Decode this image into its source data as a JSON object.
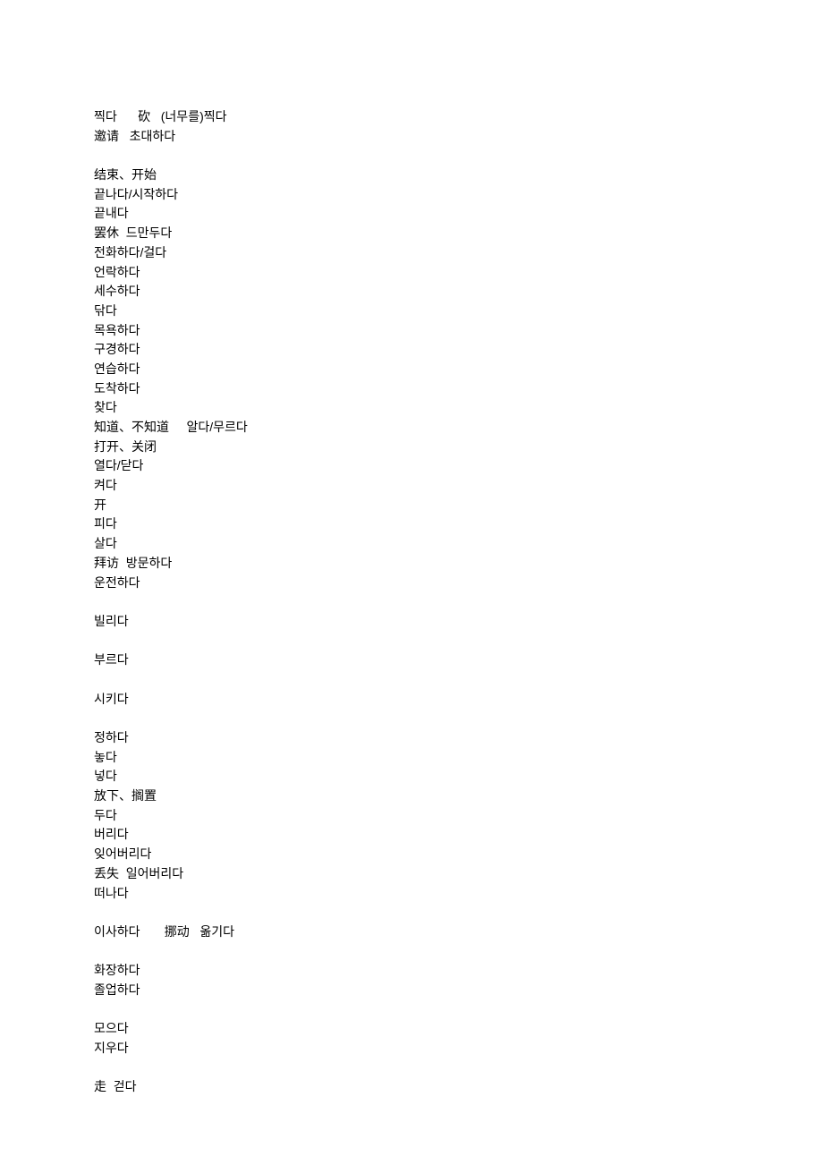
{
  "lines": [
    "찍다      砍   (너무를)찍다",
    "邀请   초대하다",
    "",
    "结束、开始",
    "끝나다/시작하다",
    "끝내다",
    "罢休  드만두다",
    "전화하다/걸다",
    "언락하다",
    "세수하다",
    "닦다",
    "목욕하다",
    "구경하다",
    "연습하다",
    "도착하다",
    "찾다",
    "知道、不知道     알다/무르다",
    "打开、关闭",
    "열다/닫다",
    "켜다",
    "开",
    "피다",
    "살다",
    "拜访  방문하다",
    "운전하다",
    "",
    "빌리다",
    "",
    "부르다",
    "",
    "시키다",
    "",
    "정하다",
    "놓다",
    "넣다",
    "放下、搁置",
    "두다",
    "버리다",
    "잊어버리다",
    "丢失  일어버리다",
    "떠나다",
    "",
    "이사하다       挪动   옮기다",
    "",
    "화장하다",
    "졸업하다",
    "",
    "모으다",
    "지우다",
    "",
    "走  걷다"
  ]
}
